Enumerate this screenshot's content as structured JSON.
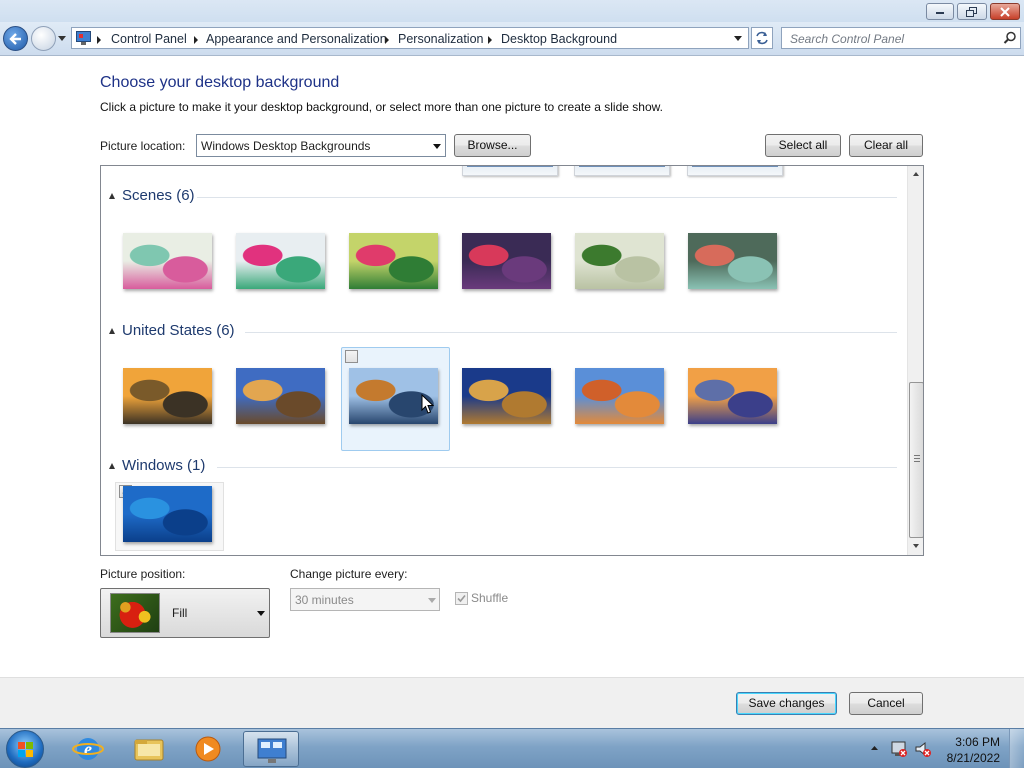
{
  "window": {
    "minimize_icon": "minimize-icon",
    "maximize_icon": "restore-icon",
    "close_icon": "close-icon"
  },
  "nav": {
    "breadcrumbs": [
      "Control Panel",
      "Appearance and Personalization",
      "Personalization",
      "Desktop Background"
    ],
    "search_placeholder": "Search Control Panel"
  },
  "page": {
    "heading": "Choose your desktop background",
    "subheading": "Click a picture to make it your desktop background, or select more than one picture to create a slide show.",
    "picture_location_label": "Picture location:",
    "picture_location_value": "Windows Desktop Backgrounds",
    "browse_label": "Browse...",
    "select_all_label": "Select all",
    "clear_all_label": "Clear all"
  },
  "groups": [
    {
      "title": "Scenes (6)",
      "pictures": [
        {
          "name": "scene-1",
          "colors": [
            "#e9eee4",
            "#7fc7b0",
            "#d85c9c"
          ]
        },
        {
          "name": "scene-2",
          "colors": [
            "#e8eef1",
            "#e1327e",
            "#3aa87a"
          ]
        },
        {
          "name": "scene-3",
          "colors": [
            "#c4d46a",
            "#e03b6b",
            "#2f7d35"
          ]
        },
        {
          "name": "scene-4",
          "colors": [
            "#3a2b55",
            "#d8395a",
            "#6a3a7c"
          ]
        },
        {
          "name": "scene-5",
          "colors": [
            "#dfe4d2",
            "#3c7a2e",
            "#b9c2a3"
          ]
        },
        {
          "name": "scene-6",
          "colors": [
            "#4e6a5a",
            "#d76b5b",
            "#8ac2b4"
          ]
        }
      ]
    },
    {
      "title": "United States (6)",
      "pictures": [
        {
          "name": "us-1",
          "colors": [
            "#f0a43a",
            "#7a5a2a",
            "#3b3225"
          ]
        },
        {
          "name": "us-2",
          "colors": [
            "#3f6cc2",
            "#e2a650",
            "#6a4a2a"
          ]
        },
        {
          "name": "us-3",
          "colors": [
            "#9fc1e6",
            "#c47a2e",
            "#28466e"
          ]
        },
        {
          "name": "us-4",
          "colors": [
            "#1a3a8a",
            "#d8a34a",
            "#b07a30"
          ]
        },
        {
          "name": "us-5",
          "colors": [
            "#5a8fd8",
            "#d0602a",
            "#e38a3a"
          ]
        },
        {
          "name": "us-6",
          "colors": [
            "#f1a046",
            "#5e6fa8",
            "#3b3f8a"
          ]
        }
      ]
    },
    {
      "title": "Windows (1)",
      "pictures": [
        {
          "name": "windows-1",
          "colors": [
            "#1e6bc8",
            "#2a92e0",
            "#0b3f8a"
          ]
        }
      ]
    }
  ],
  "options": {
    "position_label": "Picture position:",
    "position_value": "Fill",
    "change_label": "Change picture every:",
    "change_value": "30 minutes",
    "shuffle_label": "Shuffle",
    "shuffle_checked": true
  },
  "footer": {
    "save_label": "Save changes",
    "cancel_label": "Cancel"
  },
  "taskbar": {
    "apps": [
      "internet-explorer-icon",
      "windows-explorer-icon",
      "media-player-icon",
      "control-panel-icon"
    ],
    "time": "3:06 PM",
    "date": "8/21/2022"
  }
}
